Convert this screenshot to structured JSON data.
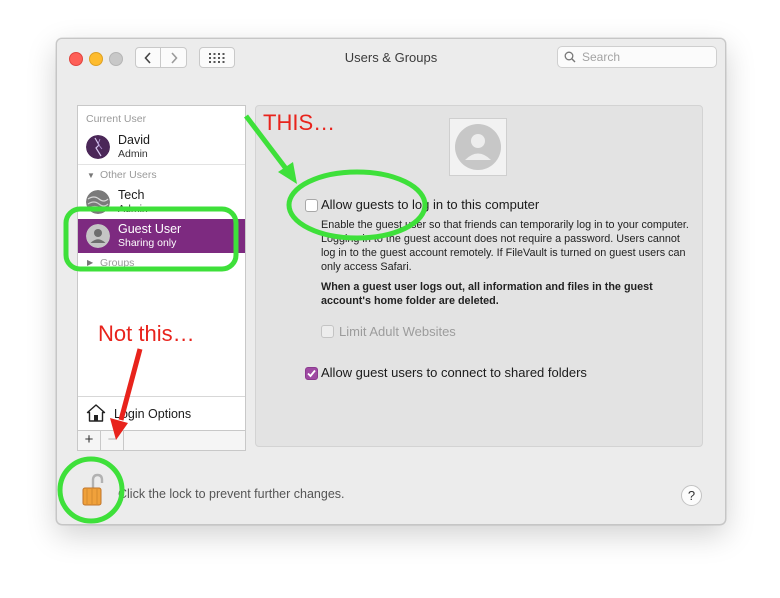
{
  "window": {
    "title": "Users & Groups",
    "search_placeholder": "Search"
  },
  "sidebar": {
    "current_user_label": "Current User",
    "other_users_label": "Other Users",
    "groups_label": "Groups",
    "users": [
      {
        "name": "David",
        "role": "Admin"
      },
      {
        "name": "Tech",
        "role": "Admin"
      },
      {
        "name": "Guest User",
        "role": "Sharing only",
        "selected": true
      }
    ],
    "login_options_label": "Login Options",
    "add_label": "+",
    "remove_label": "−"
  },
  "content": {
    "allow_guest_login_label": "Allow guests to log in to this computer",
    "allow_guest_login_checked": false,
    "description": "Enable the guest user so that friends can temporarily log in to your computer. Logging in to the guest account does not require a password. Users cannot log in to the guest account remotely. If FileVault is turned on guest users can only access Safari.",
    "warning": "When a guest user logs out, all information and files in the guest account's home folder are deleted.",
    "limit_adult_label": "Limit Adult Websites",
    "limit_adult_checked": false,
    "shared_folders_label": "Allow guest users to connect to shared folders",
    "shared_folders_checked": true
  },
  "footer": {
    "lock_text": "Click the lock to prevent further changes.",
    "help_label": "?"
  },
  "annotations": {
    "this_label": "THIS…",
    "not_this_label": "Not this…",
    "colors": {
      "highlight": "#3ee03a",
      "arrow_green": "#3ee03a",
      "arrow_red": "#e8231c"
    }
  },
  "colors": {
    "selection": "#7d2a80",
    "checkbox_checked": "#9f4aa3"
  }
}
